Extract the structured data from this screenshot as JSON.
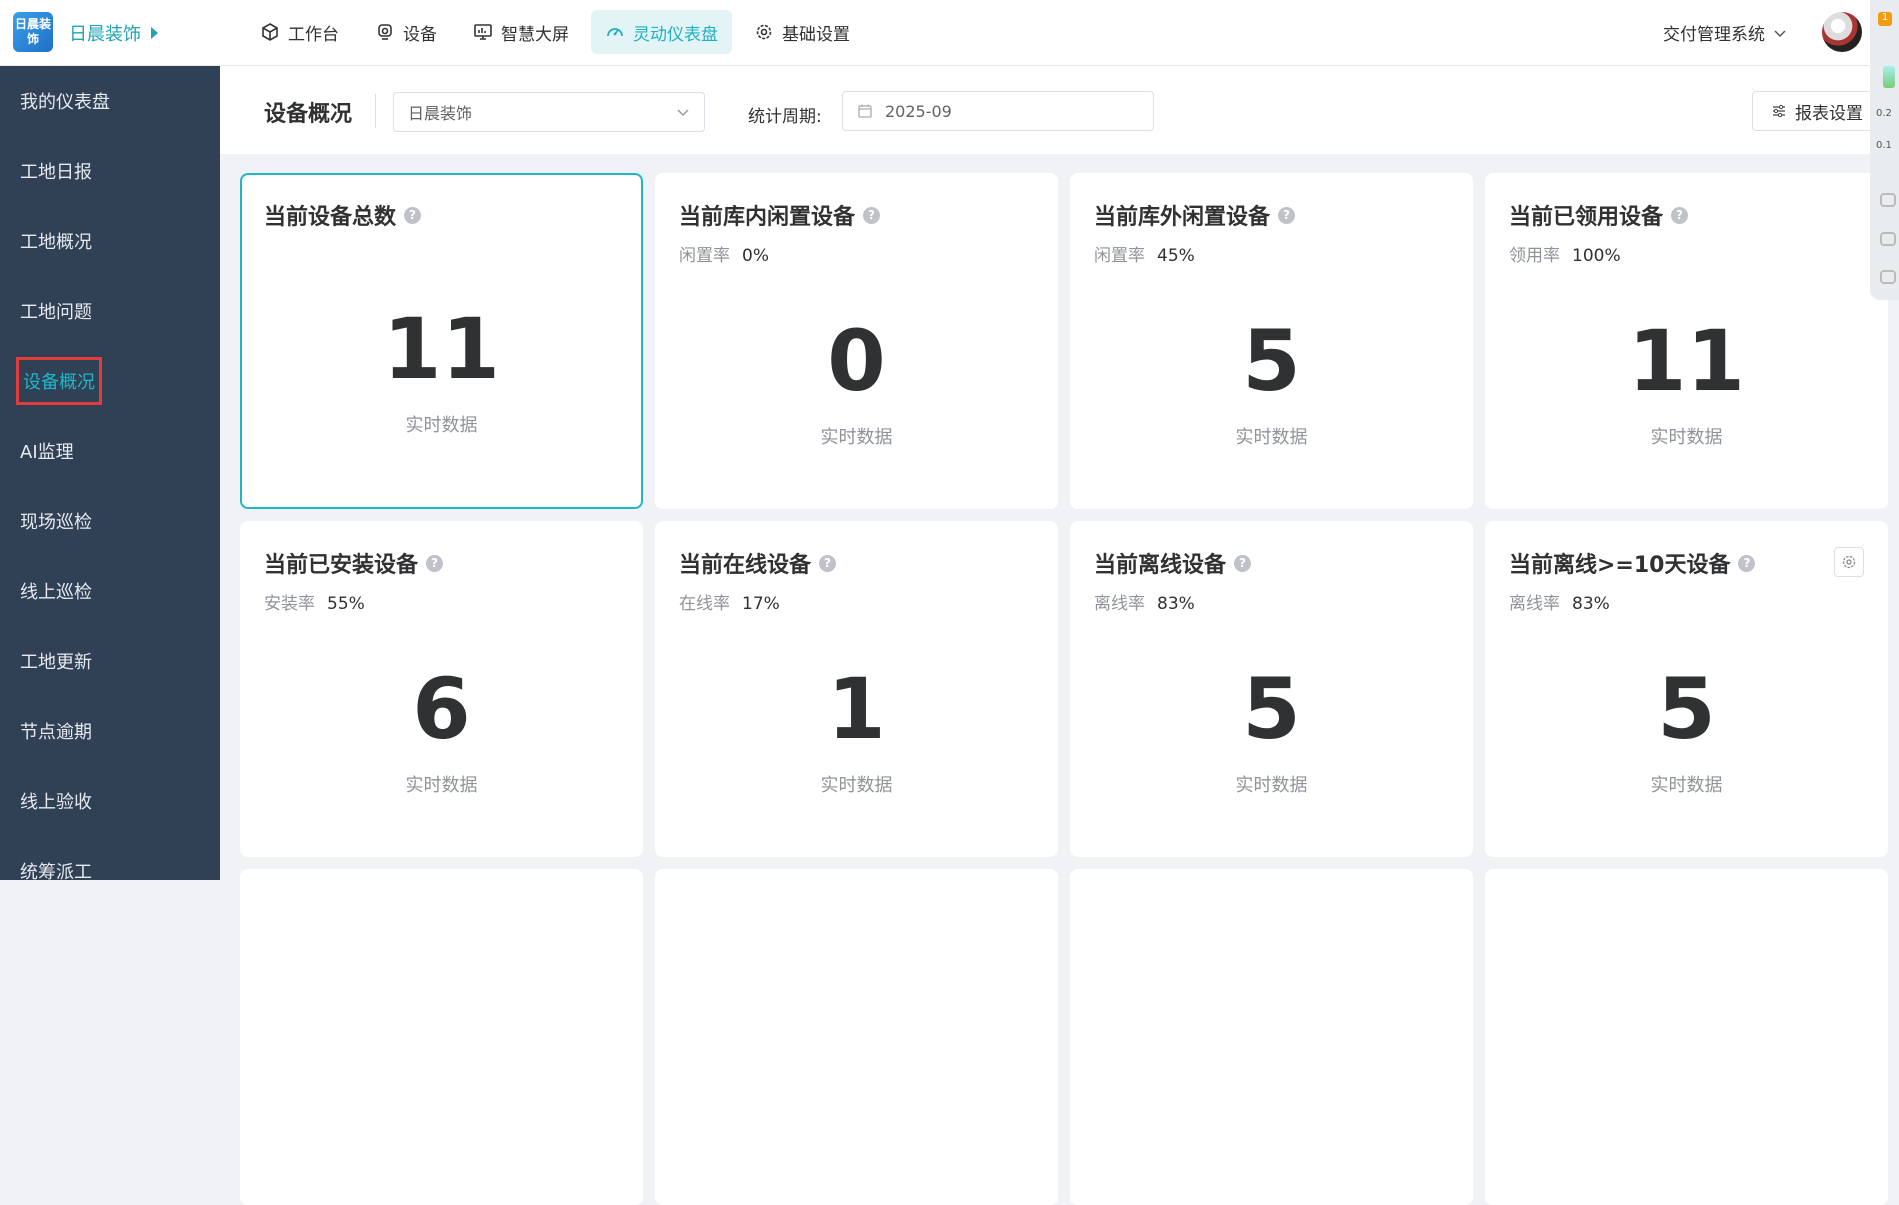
{
  "brand": {
    "logo_text": "日晨装饰",
    "name": "日晨装饰"
  },
  "nav": [
    {
      "label": "工作台",
      "icon": "cube-icon"
    },
    {
      "label": "设备",
      "icon": "camera-icon"
    },
    {
      "label": "智慧大屏",
      "icon": "monitor-icon"
    },
    {
      "label": "灵动仪表盘",
      "icon": "gauge-icon",
      "active": true
    },
    {
      "label": "基础设置",
      "icon": "gear-icon"
    }
  ],
  "system_switch": "交付管理系统",
  "sidebar": [
    {
      "label": "我的仪表盘"
    },
    {
      "label": "工地日报"
    },
    {
      "label": "工地概况"
    },
    {
      "label": "工地问题"
    },
    {
      "label": "设备概况",
      "selected": true
    },
    {
      "label": "AI监理"
    },
    {
      "label": "现场巡检"
    },
    {
      "label": "线上巡检"
    },
    {
      "label": "工地更新"
    },
    {
      "label": "节点逾期"
    },
    {
      "label": "线上验收"
    },
    {
      "label": "统筹派工"
    }
  ],
  "filters": {
    "page_title": "设备概况",
    "company_select": "日晨装饰",
    "period_label": "统计周期:",
    "period_value": "2025-09",
    "report_settings": "报表设置"
  },
  "cards": [
    {
      "title": "当前设备总数",
      "rate_label": "",
      "rate_value": "",
      "value": "11",
      "sub": "实时数据"
    },
    {
      "title": "当前库内闲置设备",
      "rate_label": "闲置率",
      "rate_value": "0%",
      "value": "0",
      "sub": "实时数据"
    },
    {
      "title": "当前库外闲置设备",
      "rate_label": "闲置率",
      "rate_value": "45%",
      "value": "5",
      "sub": "实时数据"
    },
    {
      "title": "当前已领用设备",
      "rate_label": "领用率",
      "rate_value": "100%",
      "value": "11",
      "sub": "实时数据"
    },
    {
      "title": "当前已安装设备",
      "rate_label": "安装率",
      "rate_value": "55%",
      "value": "6",
      "sub": "实时数据"
    },
    {
      "title": "当前在线设备",
      "rate_label": "在线率",
      "rate_value": "17%",
      "value": "1",
      "sub": "实时数据"
    },
    {
      "title": "当前离线设备",
      "rate_label": "离线率",
      "rate_value": "83%",
      "value": "5",
      "sub": "实时数据"
    },
    {
      "title": "当前离线>=10天设备",
      "rate_label": "离线率",
      "rate_value": "83%",
      "value": "5",
      "sub": "实时数据"
    }
  ],
  "tools": {
    "badge": "1",
    "up_speed": "0.2",
    "down_speed": "0.1"
  },
  "colors": {
    "accent": "#1fb6c8",
    "sidebar_bg": "#304156",
    "highlight": "#e23c3c"
  }
}
